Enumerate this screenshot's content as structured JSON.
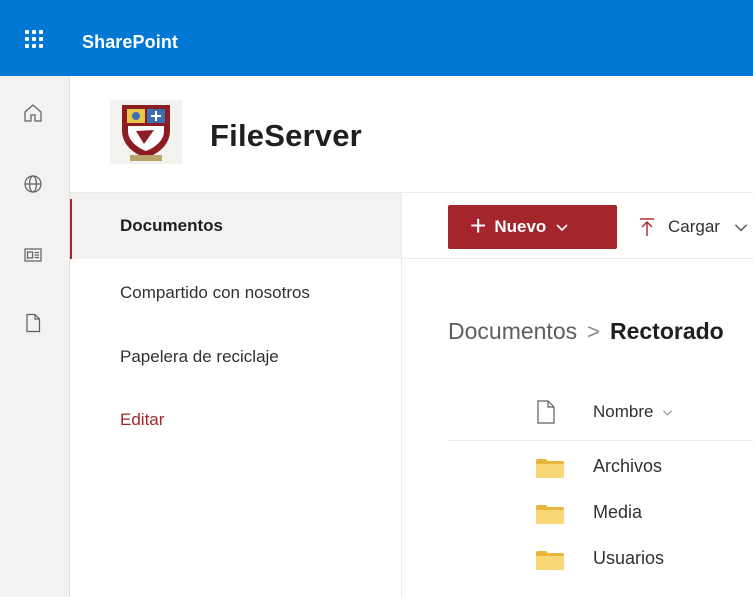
{
  "suite": {
    "brand": "SharePoint"
  },
  "rail": {
    "icons": [
      "home-icon",
      "globe-icon",
      "news-icon",
      "document-icon"
    ]
  },
  "site": {
    "title": "FileServer"
  },
  "nav": {
    "items": [
      {
        "label": "Documentos",
        "selected": true
      },
      {
        "label": "Compartido con nosotros"
      },
      {
        "label": "Papelera de reciclaje"
      },
      {
        "label": "Editar"
      }
    ]
  },
  "commands": {
    "new_label": "Nuevo",
    "upload_label": "Cargar"
  },
  "breadcrumb": {
    "root": "Documentos",
    "separator": ">",
    "current": "Rectorado"
  },
  "list": {
    "column_name": "Nombre",
    "rows": [
      {
        "name": "Archivos"
      },
      {
        "name": "Media"
      },
      {
        "name": "Usuarios"
      }
    ]
  },
  "colors": {
    "accent": "#0078d4",
    "brand_red": "#a4262c",
    "folder": "#f8d775"
  }
}
